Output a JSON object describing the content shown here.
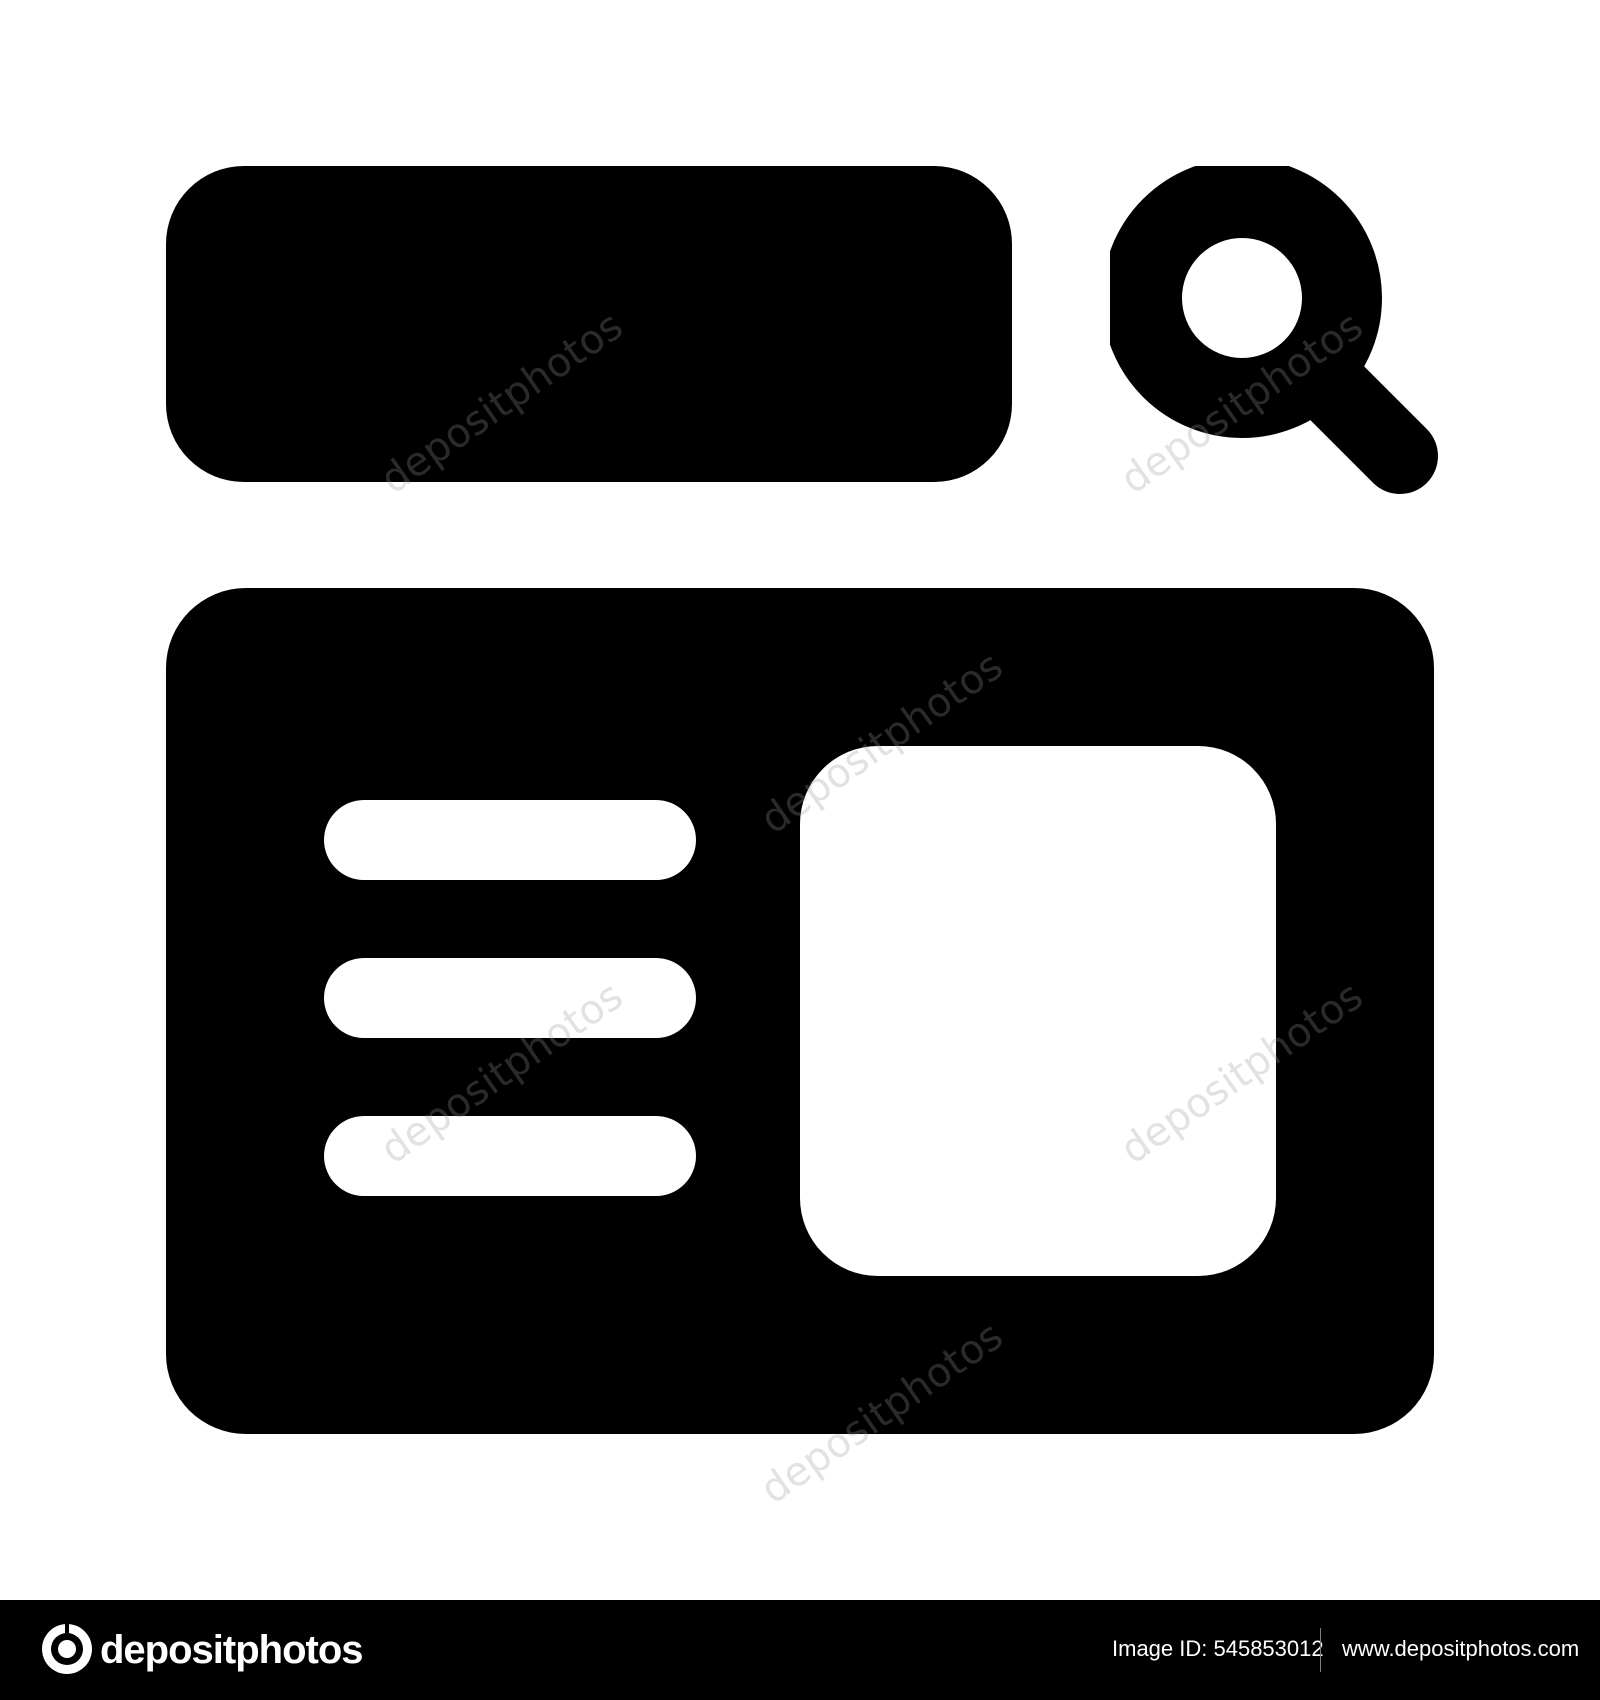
{
  "icon": {
    "name": "search-browser-icon",
    "colors": {
      "foreground": "#000000",
      "background": "#ffffff"
    }
  },
  "watermark": {
    "text": "depositphotos"
  },
  "footer": {
    "brand": "depositphotos",
    "image_id": "Image ID: 545853012",
    "url": "www.depositphotos.com",
    "background": "#000000",
    "text_color": "#ffffff"
  }
}
